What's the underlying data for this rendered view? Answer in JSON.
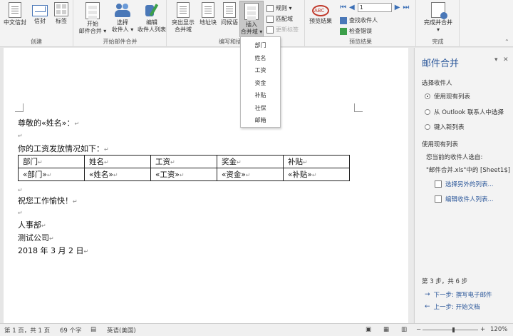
{
  "ribbon": {
    "groups": {
      "create": {
        "label": "创建",
        "buttons": [
          "中文信封",
          "信封",
          "标签"
        ]
      },
      "start": {
        "label": "开始邮件合并",
        "start_btn": [
          "开始",
          "邮件合并 ▾"
        ],
        "select_btn": [
          "选择",
          "收件人 ▾"
        ],
        "edit_btn": [
          "编辑",
          "收件人列表"
        ]
      },
      "write": {
        "label": "编写和插入域",
        "highlight_btn": [
          "突出显示",
          "合并域"
        ],
        "address_btn": "地址块",
        "greeting_btn": "问候语",
        "insert_btn": [
          "插入",
          "合并域 ▾"
        ],
        "rules": "规则 ▾",
        "match": "匹配域",
        "update": "更新标签"
      },
      "preview": {
        "label": "预览结果",
        "preview_btn": "预览结果",
        "record": "1",
        "find": "查找收件人",
        "check": "检查错误"
      },
      "finish": {
        "label": "完成",
        "finish_btn": [
          "完成并合并",
          "▾"
        ]
      }
    }
  },
  "dropdown": {
    "items": [
      "部门",
      "姓名",
      "工资",
      "资金",
      "补贴",
      "社保",
      "邮箱"
    ]
  },
  "document": {
    "greeting": "尊敬的«姓名»：",
    "intro": "你的工资发放情况如下：",
    "table": {
      "headers": [
        "部门",
        "姓名",
        "工资",
        "奖金",
        "补贴"
      ],
      "row": [
        "«部门»",
        "«姓名»",
        "«工资»",
        "«资金»",
        "«补贴»"
      ]
    },
    "wish": "祝您工作愉快！",
    "sign_dept": "人事部",
    "sign_company": "测试公司",
    "date": "2018 年 3 月 2 日",
    "para_mark": "↵"
  },
  "pane": {
    "title": "邮件合并",
    "section1": "选择收件人",
    "options": [
      "使用现有列表",
      "从 Outlook 联系人中选择",
      "键入新列表"
    ],
    "selected_index": 0,
    "section2": "使用现有列表",
    "current_from": "您当前的收件人选自:",
    "source": "\"邮件合并.xls\"中的 [Sheet1$]",
    "link_other": "选择另外的列表...",
    "link_edit": "编辑收件人列表...",
    "step": "第 3 步，共 6 步",
    "next": "下一步: 撰写电子邮件",
    "prev": "上一步: 开始文档"
  },
  "status": {
    "page": "第 1 页，共 1 页",
    "words": "69 个字",
    "lang": "英语(美国)",
    "zoom": "120%",
    "minus": "−",
    "plus": "+"
  }
}
